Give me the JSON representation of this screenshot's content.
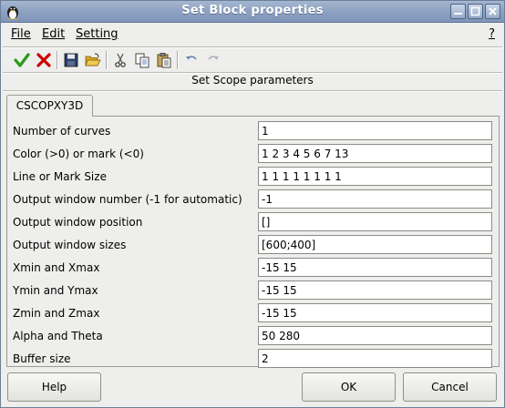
{
  "window": {
    "title": "Set Block properties"
  },
  "menu": {
    "file": "File",
    "edit": "Edit",
    "setting": "Setting",
    "help": "?"
  },
  "toolbar": {
    "icons": [
      "ok-icon",
      "cancel-icon",
      "save-icon",
      "open-icon",
      "cut-icon",
      "copy-icon",
      "paste-icon",
      "undo-icon",
      "redo-icon"
    ]
  },
  "section_title": "Set Scope parameters",
  "tab": {
    "label": "CSCOPXY3D"
  },
  "params": [
    {
      "label": "Number of curves",
      "value": "1"
    },
    {
      "label": "Color (>0) or mark (<0)",
      "value": "1 2 3 4 5 6 7 13"
    },
    {
      "label": "Line or Mark Size",
      "value": "1 1 1 1 1 1 1 1"
    },
    {
      "label": "Output window number (-1 for automatic)",
      "value": "-1"
    },
    {
      "label": "Output window position",
      "value": "[]"
    },
    {
      "label": "Output window sizes",
      "value": "[600;400]"
    },
    {
      "label": "Xmin and Xmax",
      "value": "-15 15"
    },
    {
      "label": "Ymin and Ymax",
      "value": "-15 15"
    },
    {
      "label": "Zmin and Zmax",
      "value": "-15 15"
    },
    {
      "label": "Alpha and Theta",
      "value": "50 280"
    },
    {
      "label": "Buffer size",
      "value": "2"
    }
  ],
  "buttons": {
    "help": "Help",
    "ok": "OK",
    "cancel": "Cancel"
  },
  "colors": {
    "titlebar": "#8da2c2",
    "accept_check": "#2a9a1a",
    "reject_x": "#cc0000"
  }
}
